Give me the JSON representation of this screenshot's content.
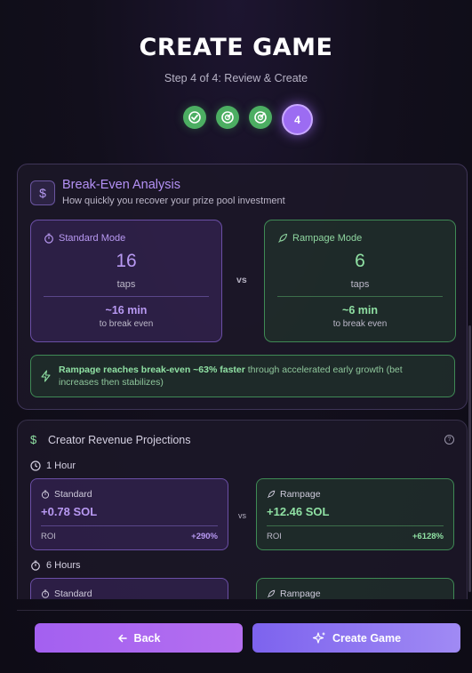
{
  "header": {
    "title": "CREATE GAME",
    "subtitle": "Step 4 of 4: Review & Create",
    "steps": [
      {
        "state": "done",
        "icon": "check-circle-icon"
      },
      {
        "state": "done",
        "icon": "target-check-icon"
      },
      {
        "state": "done",
        "icon": "target-check-icon"
      },
      {
        "state": "current",
        "label": "4"
      }
    ]
  },
  "break_even": {
    "icon": "dollar-icon",
    "title": "Break-Even Analysis",
    "subtitle": "How quickly you recover your prize pool investment",
    "standard": {
      "label": "Standard Mode",
      "icon": "timer-icon",
      "taps": "16",
      "taps_label": "taps",
      "time": "~16 min",
      "time_label": "to break even"
    },
    "vs": "vs",
    "rampage": {
      "label": "Rampage Mode",
      "icon": "rocket-icon",
      "taps": "6",
      "taps_label": "taps",
      "time": "~6 min",
      "time_label": "to break even"
    },
    "insight": {
      "icon": "lightning-icon",
      "highlight": "Rampage reaches break-even ~63% faster",
      "rest": " through accelerated early growth (bet increases then stabilizes)"
    }
  },
  "revenue": {
    "icon": "dollar-icon",
    "title": "Creator Revenue Projections",
    "help_icon": "?",
    "periods": [
      {
        "label": "1 Hour",
        "standard": {
          "label": "Standard",
          "value": "+0.78 SOL",
          "roi_label": "ROI",
          "roi": "+290%"
        },
        "vs": "vs",
        "rampage": {
          "label": "Rampage",
          "value": "+12.46 SOL",
          "roi_label": "ROI",
          "roi": "+6128%"
        }
      },
      {
        "label": "6 Hours",
        "standard": {
          "label": "Standard"
        },
        "rampage": {
          "label": "Rampage"
        }
      }
    ]
  },
  "footer": {
    "back_label": "Back",
    "create_label": "Create Game"
  },
  "colors": {
    "accent_purple": "#9c6cf2",
    "accent_green": "#4cae62",
    "background": "#120f1c"
  }
}
